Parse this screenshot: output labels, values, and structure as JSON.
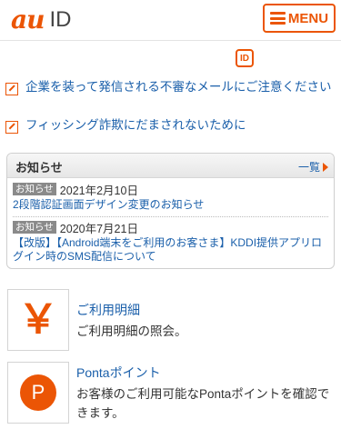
{
  "header": {
    "logo_brand": "au",
    "logo_suffix": "ID",
    "menu_label": "MENU"
  },
  "id_badge": "ID",
  "notices": [
    {
      "text": "企業を装って発信される不審なメールにご注意ください"
    },
    {
      "text": "フィッシング詐欺にだまされないために"
    }
  ],
  "news": {
    "title": "お知らせ",
    "more_label": "一覧",
    "items": [
      {
        "tag": "お知らせ",
        "date": "2021年2月10日",
        "text": "2段階認証画面デザイン変更のお知らせ"
      },
      {
        "tag": "お知らせ",
        "date": "2020年7月21日",
        "text": "【改版】【Android端末をご利用のお客さま】KDDI提供アプリログイン時のSMS配信について"
      }
    ]
  },
  "services": [
    {
      "icon": "yen-icon",
      "glyph": "￥",
      "title": "ご利用明細",
      "desc": "ご利用明細の照会。"
    },
    {
      "icon": "ponta-icon",
      "glyph": "P",
      "title": "Pontaポイント",
      "desc": "お客様のご利用可能なPontaポイントを確認できます。"
    }
  ],
  "colors": {
    "accent": "#eb5505",
    "link": "#1a5faa",
    "tag": "#8a8a8a"
  }
}
